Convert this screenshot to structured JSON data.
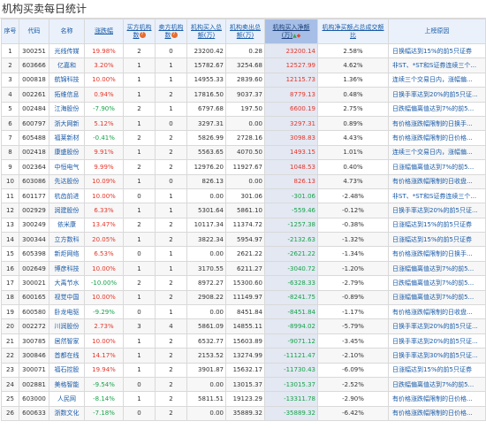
{
  "page": {
    "title": "机构买卖每日统计"
  },
  "headers": {
    "seq": "序号",
    "code": "代码",
    "name": "名称",
    "change": "涨跌幅",
    "buy_count": "买方机构数",
    "buy_badge": "?",
    "sell_count": "卖方机构数",
    "sell_badge": "?",
    "buy_amt": "机构买入总额(万)",
    "sell_amt": "机构卖出总额(万)",
    "net_buy": "机构买入净额(万)",
    "sort_asc_icon": "▲",
    "sort_desc_icon": "◆",
    "ratio": "机构净买额占总成交额比",
    "reason": "上榜原因"
  },
  "rows": [
    {
      "seq": "1",
      "code": "300251",
      "name": "光线传媒",
      "change": "19.98%",
      "dir": "up",
      "buy": "2",
      "sell": "0",
      "buy_amt": "23200.42",
      "sell_amt": "0.28",
      "net": "23200.14",
      "net_dir": "up",
      "ratio": "2.58%",
      "reason": "日换幅达到15%的前5只证券"
    },
    {
      "seq": "2",
      "code": "603666",
      "name": "亿嘉和",
      "change": "3.20%",
      "dir": "up",
      "buy": "1",
      "sell": "1",
      "buy_amt": "15782.67",
      "sell_amt": "3254.68",
      "net": "12527.99",
      "net_dir": "up",
      "ratio": "4.62%",
      "reason": "非ST、*ST和S证券连续三个..."
    },
    {
      "seq": "3",
      "code": "000818",
      "name": "航锦科技",
      "change": "10.00%",
      "dir": "up",
      "buy": "1",
      "sell": "1",
      "buy_amt": "14955.33",
      "sell_amt": "2839.60",
      "net": "12115.73",
      "net_dir": "up",
      "ratio": "1.36%",
      "reason": "连续三个交易日内，涨幅偏..."
    },
    {
      "seq": "4",
      "code": "002261",
      "name": "拓维信息",
      "change": "0.94%",
      "dir": "up",
      "buy": "1",
      "sell": "2",
      "buy_amt": "17816.50",
      "sell_amt": "9037.37",
      "net": "8779.13",
      "net_dir": "up",
      "ratio": "0.48%",
      "reason": "日换手率达到20%的前5只证..."
    },
    {
      "seq": "5",
      "code": "002484",
      "name": "江海股份",
      "change": "-7.90%",
      "dir": "down",
      "buy": "2",
      "sell": "1",
      "buy_amt": "6797.68",
      "sell_amt": "197.50",
      "net": "6600.19",
      "net_dir": "up",
      "ratio": "2.75%",
      "reason": "日跌幅偏离值达到7%的前5..."
    },
    {
      "seq": "6",
      "code": "600797",
      "name": "浙大网新",
      "change": "5.12%",
      "dir": "up",
      "buy": "1",
      "sell": "0",
      "buy_amt": "3297.31",
      "sell_amt": "0.00",
      "net": "3297.31",
      "net_dir": "up",
      "ratio": "0.89%",
      "reason": "有价格涨跌幅限制的日换手..."
    },
    {
      "seq": "7",
      "code": "605488",
      "name": "福莱新材",
      "change": "-0.41%",
      "dir": "down",
      "buy": "2",
      "sell": "2",
      "buy_amt": "5826.99",
      "sell_amt": "2728.16",
      "net": "3098.83",
      "net_dir": "up",
      "ratio": "4.43%",
      "reason": "有价格涨跌幅限制的日价格..."
    },
    {
      "seq": "8",
      "code": "002418",
      "name": "康盛股份",
      "change": "9.91%",
      "dir": "up",
      "buy": "1",
      "sell": "2",
      "buy_amt": "5563.65",
      "sell_amt": "4070.50",
      "net": "1493.15",
      "net_dir": "up",
      "ratio": "1.01%",
      "reason": "连续三个交易日内，涨幅偏..."
    },
    {
      "seq": "9",
      "code": "002364",
      "name": "中恒电气",
      "change": "9.99%",
      "dir": "up",
      "buy": "2",
      "sell": "2",
      "buy_amt": "12976.20",
      "sell_amt": "11927.67",
      "net": "1048.53",
      "net_dir": "up",
      "ratio": "0.40%",
      "reason": "日涨幅偏离值达到7%的前5..."
    },
    {
      "seq": "10",
      "code": "603086",
      "name": "先达股份",
      "change": "10.09%",
      "dir": "up",
      "buy": "1",
      "sell": "0",
      "buy_amt": "826.13",
      "sell_amt": "0.00",
      "net": "826.13",
      "net_dir": "up",
      "ratio": "4.73%",
      "reason": "有价格涨跌幅限制的日收盘..."
    },
    {
      "seq": "11",
      "code": "601177",
      "name": "杭齿前进",
      "change": "10.00%",
      "dir": "up",
      "buy": "0",
      "sell": "1",
      "buy_amt": "0.00",
      "sell_amt": "301.06",
      "net": "-301.06",
      "net_dir": "down",
      "ratio": "-2.48%",
      "reason": "非ST、*ST和S证券连续三个..."
    },
    {
      "seq": "12",
      "code": "002929",
      "name": "润建股份",
      "change": "6.33%",
      "dir": "up",
      "buy": "1",
      "sell": "1",
      "buy_amt": "5301.64",
      "sell_amt": "5861.10",
      "net": "-559.46",
      "net_dir": "down",
      "ratio": "-0.12%",
      "reason": "日换手率达到20%的前5只证..."
    },
    {
      "seq": "13",
      "code": "300249",
      "name": "依米康",
      "change": "13.47%",
      "dir": "up",
      "buy": "2",
      "sell": "2",
      "buy_amt": "10117.34",
      "sell_amt": "11374.72",
      "net": "-1257.38",
      "net_dir": "down",
      "ratio": "-0.38%",
      "reason": "日涨幅达到15%的前5只证券"
    },
    {
      "seq": "14",
      "code": "300344",
      "name": "立方数科",
      "change": "20.05%",
      "dir": "up",
      "buy": "1",
      "sell": "2",
      "buy_amt": "3822.34",
      "sell_amt": "5954.97",
      "net": "-2132.63",
      "net_dir": "down",
      "ratio": "-1.32%",
      "reason": "日涨幅达到15%的前5只证券"
    },
    {
      "seq": "15",
      "code": "605398",
      "name": "新炬网络",
      "change": "6.53%",
      "dir": "up",
      "buy": "0",
      "sell": "1",
      "buy_amt": "0.00",
      "sell_amt": "2621.22",
      "net": "-2621.22",
      "net_dir": "down",
      "ratio": "-1.34%",
      "reason": "有价格涨跌幅限制的日换手..."
    },
    {
      "seq": "16",
      "code": "002649",
      "name": "博彦科技",
      "change": "10.00%",
      "dir": "up",
      "buy": "1",
      "sell": "1",
      "buy_amt": "3170.55",
      "sell_amt": "6211.27",
      "net": "-3040.72",
      "net_dir": "down",
      "ratio": "-1.20%",
      "reason": "日涨幅偏离值达到7%的前5..."
    },
    {
      "seq": "17",
      "code": "300021",
      "name": "大禹节水",
      "change": "-10.00%",
      "dir": "down",
      "buy": "2",
      "sell": "2",
      "buy_amt": "8972.27",
      "sell_amt": "15300.60",
      "net": "-6328.33",
      "net_dir": "down",
      "ratio": "-2.79%",
      "reason": "日跌幅偏离值达到7%的前5..."
    },
    {
      "seq": "18",
      "code": "600165",
      "name": "视觉中国",
      "change": "10.00%",
      "dir": "up",
      "buy": "1",
      "sell": "2",
      "buy_amt": "2908.22",
      "sell_amt": "11149.97",
      "net": "-8241.75",
      "net_dir": "down",
      "ratio": "-0.89%",
      "reason": "日涨幅偏离值达到7%的前5..."
    },
    {
      "seq": "19",
      "code": "600580",
      "name": "卧龙电驱",
      "change": "-9.29%",
      "dir": "down",
      "buy": "0",
      "sell": "1",
      "buy_amt": "0.00",
      "sell_amt": "8451.84",
      "net": "-8451.84",
      "net_dir": "down",
      "ratio": "-1.17%",
      "reason": "有价格涨跌幅限制的日收盘..."
    },
    {
      "seq": "20",
      "code": "002272",
      "name": "川润股份",
      "change": "2.73%",
      "dir": "up",
      "buy": "3",
      "sell": "4",
      "buy_amt": "5861.09",
      "sell_amt": "14855.11",
      "net": "-8994.02",
      "net_dir": "down",
      "ratio": "-5.79%",
      "reason": "日换手率达到20%的前5只证..."
    },
    {
      "seq": "21",
      "code": "300785",
      "name": "居然智家",
      "change": "10.00%",
      "dir": "up",
      "buy": "1",
      "sell": "2",
      "buy_amt": "6532.77",
      "sell_amt": "15603.89",
      "net": "-9071.12",
      "net_dir": "down",
      "ratio": "-3.45%",
      "reason": "日换手率达到20%的前5只证..."
    },
    {
      "seq": "22",
      "code": "300846",
      "name": "首都在线",
      "change": "14.17%",
      "dir": "up",
      "buy": "1",
      "sell": "2",
      "buy_amt": "2153.52",
      "sell_amt": "13274.99",
      "net": "-11121.47",
      "net_dir": "down",
      "ratio": "-2.10%",
      "reason": "日换手率达到30%的前5只证..."
    },
    {
      "seq": "23",
      "code": "300071",
      "name": "福石控股",
      "change": "19.94%",
      "dir": "up",
      "buy": "1",
      "sell": "2",
      "buy_amt": "3901.87",
      "sell_amt": "15632.17",
      "net": "-11730.43",
      "net_dir": "down",
      "ratio": "-6.09%",
      "reason": "日涨幅达到15%的前5只证券"
    },
    {
      "seq": "24",
      "code": "002881",
      "name": "美格智能",
      "change": "-9.54%",
      "dir": "down",
      "buy": "0",
      "sell": "2",
      "buy_amt": "0.00",
      "sell_amt": "13015.37",
      "net": "-13015.37",
      "net_dir": "down",
      "ratio": "-2.52%",
      "reason": "日跌幅偏离值达到7%的前5..."
    },
    {
      "seq": "25",
      "code": "603000",
      "name": "人民网",
      "change": "-8.14%",
      "dir": "down",
      "buy": "1",
      "sell": "2",
      "buy_amt": "5811.51",
      "sell_amt": "19123.29",
      "net": "-13311.78",
      "net_dir": "down",
      "ratio": "-2.90%",
      "reason": "有价格涨跌幅限制的日价格..."
    },
    {
      "seq": "26",
      "code": "600633",
      "name": "浙数文化",
      "change": "-7.18%",
      "dir": "down",
      "buy": "0",
      "sell": "2",
      "buy_amt": "0.00",
      "sell_amt": "35889.32",
      "net": "-35889.32",
      "net_dir": "down",
      "ratio": "-6.42%",
      "reason": "有价格涨跌幅限制的日价格..."
    }
  ],
  "colors": {
    "up": "#e5362a",
    "down": "#16a34a",
    "header_bg": "#eaf1fb",
    "sorted_header_bg": "#a7bfe6",
    "link": "#1a5ba8"
  }
}
